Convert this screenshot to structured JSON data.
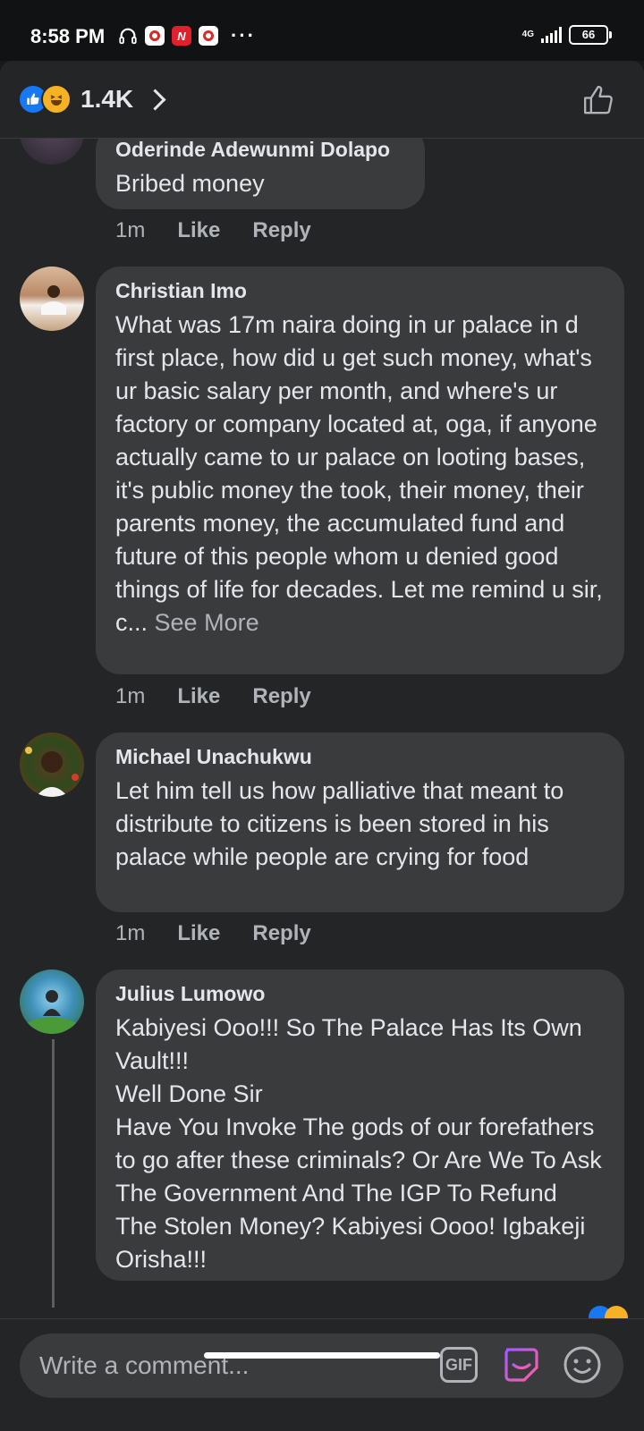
{
  "status_bar": {
    "time": "8:58 PM",
    "network": "4G",
    "battery": "66"
  },
  "header": {
    "reaction_count": "1.4K"
  },
  "comments": [
    {
      "author": "Oderinde Adewunmi Dolapo",
      "text": "Bribed money",
      "time": "1m",
      "like_label": "Like",
      "reply_label": "Reply"
    },
    {
      "author": "Christian Imo",
      "text": "What was 17m naira doing in ur palace in d first place, how did u get such money, what's ur basic salary per month, and where's ur factory or company located at, oga, if anyone actually came to ur palace on looting bases, it's public money the took, their money, their parents money, the accumulated fund and future of this people whom u denied good things of life for decades. Let me remind u sir, c...",
      "see_more": "See More",
      "time": "1m",
      "like_label": "Like",
      "reply_label": "Reply"
    },
    {
      "author": "Michael Unachukwu",
      "text": "Let him tell us how palliative that meant to distribute to citizens is been stored in his palace while people are crying for food",
      "time": "1m",
      "like_label": "Like",
      "reply_label": "Reply"
    },
    {
      "author": "Julius Lumowo",
      "text": "Kabiyesi Ooo!!! So The Palace Has Its Own Vault!!!\nWell Done Sir\nHave You Invoke The gods of our forefathers to go after these criminals? Or Are We To Ask The Government And The IGP To Refund The Stolen Money? Kabiyesi Oooo! Igbakeji Orisha!!!"
    }
  ],
  "composer": {
    "placeholder": "Write a comment...",
    "gif_label": "GIF"
  },
  "colors": {
    "background": "#242526",
    "bubble": "#3a3b3c",
    "like_blue": "#1877f2",
    "haha_yellow": "#f7b125"
  }
}
